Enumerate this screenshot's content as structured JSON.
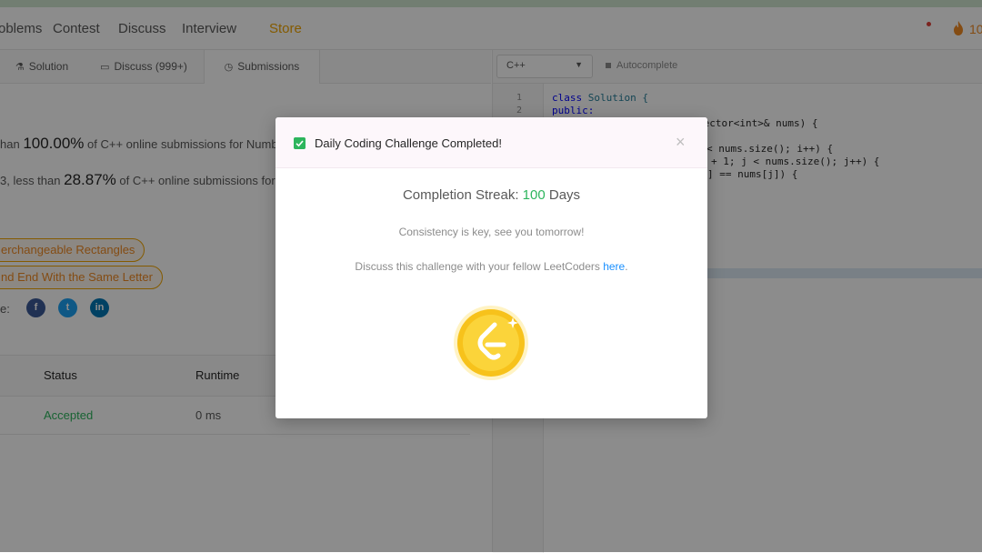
{
  "nav": {
    "items": [
      "oblems",
      "Contest",
      "Discuss",
      "Interview",
      "Store"
    ],
    "streak": "10"
  },
  "tabs": {
    "solution": "Solution",
    "discuss": "Discuss (999+)",
    "submissions": "Submissions"
  },
  "result": {
    "runtime_prefix": "han ",
    "runtime_pct": "100.00%",
    "runtime_suffix": " of C++ online submissions for Numbe",
    "memory_prefix": "3, less than ",
    "memory_pct": "28.87%",
    "memory_suffix": " of C++ online submissions for N"
  },
  "related": [
    "erchangeable Rectangles",
    "nd End With the Same Letter"
  ],
  "share": {
    "label": "e:"
  },
  "table": {
    "headers": {
      "status": "Status",
      "runtime": "Runtime"
    },
    "row": {
      "status": "Accepted",
      "runtime": "0 ms"
    }
  },
  "editor": {
    "language": "C++",
    "autocomplete": "Autocomplete",
    "line_numbers": [
      "1",
      "2"
    ],
    "code": {
      "l1_kw": "class",
      "l1_name": " Solution {",
      "l2": "public:",
      "l3": "vector<int>& nums) {",
      "l4": "< nums.size(); i++) {",
      "l5": "+ 1; j < nums.size(); j++) {",
      "l6": "] == nums[j]) {"
    }
  },
  "modal": {
    "title": "Daily Coding Challenge Completed!",
    "close": "×",
    "streak_label": "Completion Streak: ",
    "streak_value": "100",
    "streak_unit": " Days",
    "consistency": "Consistency is key, see you tomorrow!",
    "discuss_text": "Discuss this challenge with your fellow LeetCoders ",
    "discuss_link": "here",
    "discuss_end": "."
  },
  "colors": {
    "accent_green": "#2db55d",
    "brand_orange": "#f0a500",
    "link_blue": "#1a90ff"
  },
  "icons": [
    "check-icon",
    "close-icon",
    "leetcode-coin-icon",
    "fire-icon",
    "facebook-icon",
    "twitter-icon",
    "linkedin-icon"
  ]
}
